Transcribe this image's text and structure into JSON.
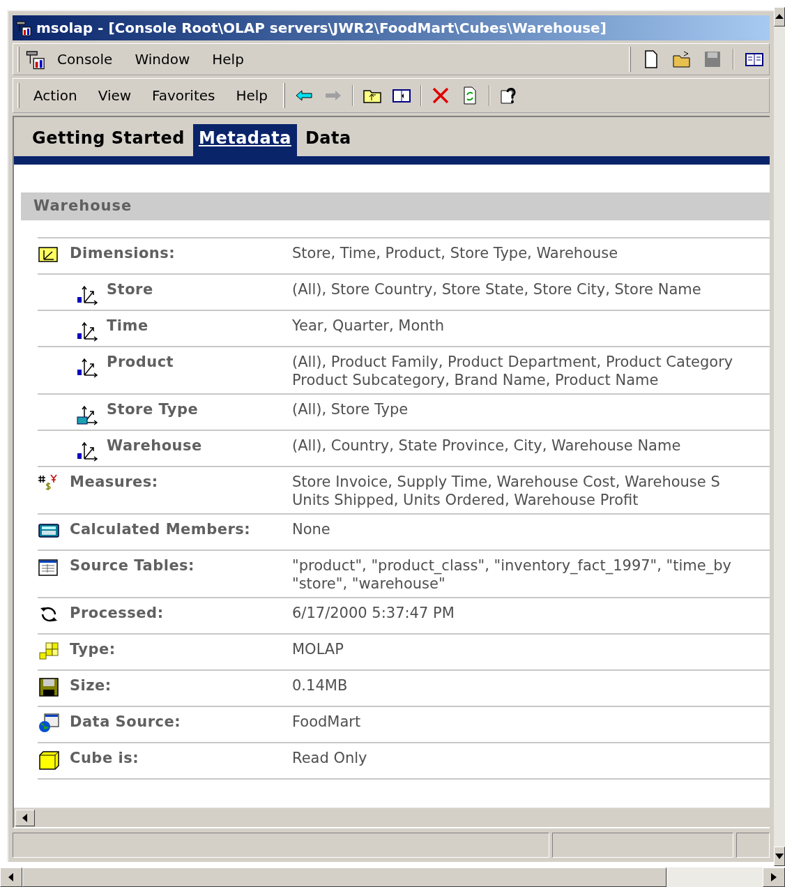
{
  "window": {
    "title": "msolap - [Console Root\\OLAP servers\\JWR2\\FoodMart\\Cubes\\Warehouse]"
  },
  "menu_bar": [
    "Console",
    "Window",
    "Help"
  ],
  "action_bar": [
    "Action",
    "View",
    "Favorites",
    "Help"
  ],
  "tabs": [
    {
      "label": "Getting Started",
      "selected": false
    },
    {
      "label": "Metadata",
      "selected": true
    },
    {
      "label": "Data",
      "selected": false
    }
  ],
  "section": {
    "title": "Warehouse"
  },
  "rows": [
    {
      "kind": "dimensions",
      "label": "Dimensions:",
      "lines": [
        "Store, Time, Product, Store Type, Warehouse"
      ],
      "children": [
        {
          "kind": "dimension",
          "label": "Store",
          "lines": [
            "(All), Store Country, Store State, Store City, Store Name"
          ]
        },
        {
          "kind": "dimension",
          "label": "Time",
          "lines": [
            "Year, Quarter, Month"
          ]
        },
        {
          "kind": "dimension",
          "label": "Product",
          "lines": [
            "(All), Product Family, Product Department, Product Category",
            "Product Subcategory, Brand Name, Product Name"
          ]
        },
        {
          "kind": "table-dimension",
          "label": "Store Type",
          "lines": [
            "(All), Store Type"
          ]
        },
        {
          "kind": "dimension",
          "label": "Warehouse",
          "lines": [
            "(All), Country, State Province, City, Warehouse Name"
          ]
        }
      ]
    },
    {
      "kind": "measures",
      "label": "Measures:",
      "lines": [
        "Store Invoice, Supply Time, Warehouse Cost, Warehouse S",
        "Units Shipped, Units Ordered, Warehouse Profit"
      ]
    },
    {
      "kind": "calculated",
      "label": "Calculated Members:",
      "lines": [
        "None"
      ]
    },
    {
      "kind": "tables",
      "label": "Source Tables:",
      "lines": [
        "\"product\", \"product_class\", \"inventory_fact_1997\", \"time_by",
        "\"store\", \"warehouse\""
      ]
    },
    {
      "kind": "processed",
      "label": "Processed:",
      "lines": [
        "6/17/2000 5:37:47 PM"
      ]
    },
    {
      "kind": "type",
      "label": "Type:",
      "lines": [
        "MOLAP"
      ]
    },
    {
      "kind": "size",
      "label": "Size:",
      "lines": [
        "0.14MB"
      ]
    },
    {
      "kind": "source",
      "label": "Data Source:",
      "lines": [
        "FoodMart"
      ]
    },
    {
      "kind": "cube",
      "label": "Cube is:",
      "lines": [
        "Read Only"
      ]
    }
  ]
}
